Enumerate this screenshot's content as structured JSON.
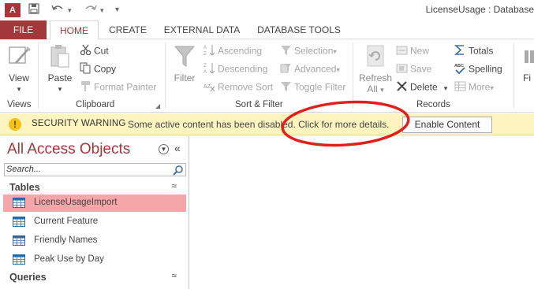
{
  "window": {
    "app_logo": "A",
    "title": "LicenseUsage : Database",
    "qat": {
      "save_icon": "save-icon",
      "undo_icon": "undo-icon",
      "redo_icon": "redo-icon",
      "customize": "▾"
    }
  },
  "tabs": [
    {
      "label": "FILE"
    },
    {
      "label": "HOME",
      "active": true
    },
    {
      "label": "CREATE"
    },
    {
      "label": "EXTERNAL DATA"
    },
    {
      "label": "DATABASE TOOLS"
    }
  ],
  "ribbon": {
    "views": {
      "label": "Views",
      "view": "View"
    },
    "clipboard": {
      "label": "Clipboard",
      "paste": "Paste",
      "cut": "Cut",
      "copy": "Copy",
      "format_painter": "Format Painter"
    },
    "sort_filter": {
      "label": "Sort & Filter",
      "filter": "Filter",
      "ascending": "Ascending",
      "descending": "Descending",
      "remove_sort": "Remove Sort",
      "selection": "Selection",
      "advanced": "Advanced",
      "toggle_filter": "Toggle Filter"
    },
    "records": {
      "label": "Records",
      "refresh": "Refresh",
      "refresh_all": "All",
      "new": "New",
      "save": "Save",
      "delete": "Delete",
      "totals": "Totals",
      "spelling": "Spelling",
      "more": "More"
    },
    "find": {
      "label": "Fi"
    }
  },
  "security_bar": {
    "title": "SECURITY WARNING",
    "message": "Some active content has been disabled. Click for more details.",
    "button": "Enable Content"
  },
  "nav_pane": {
    "title": "All Access Objects",
    "search_placeholder": "Search...",
    "sections": [
      {
        "label": "Tables",
        "items": [
          "LicenseUsageImport",
          "Current Feature",
          "Friendly Names",
          "Peak Use by Day"
        ]
      },
      {
        "label": "Queries",
        "items": []
      }
    ]
  },
  "colors": {
    "accent": "#a4373a",
    "warning_bar": "#fdf4bf",
    "selected_item": "#f4a6a8",
    "annotation": "#e0201b"
  }
}
